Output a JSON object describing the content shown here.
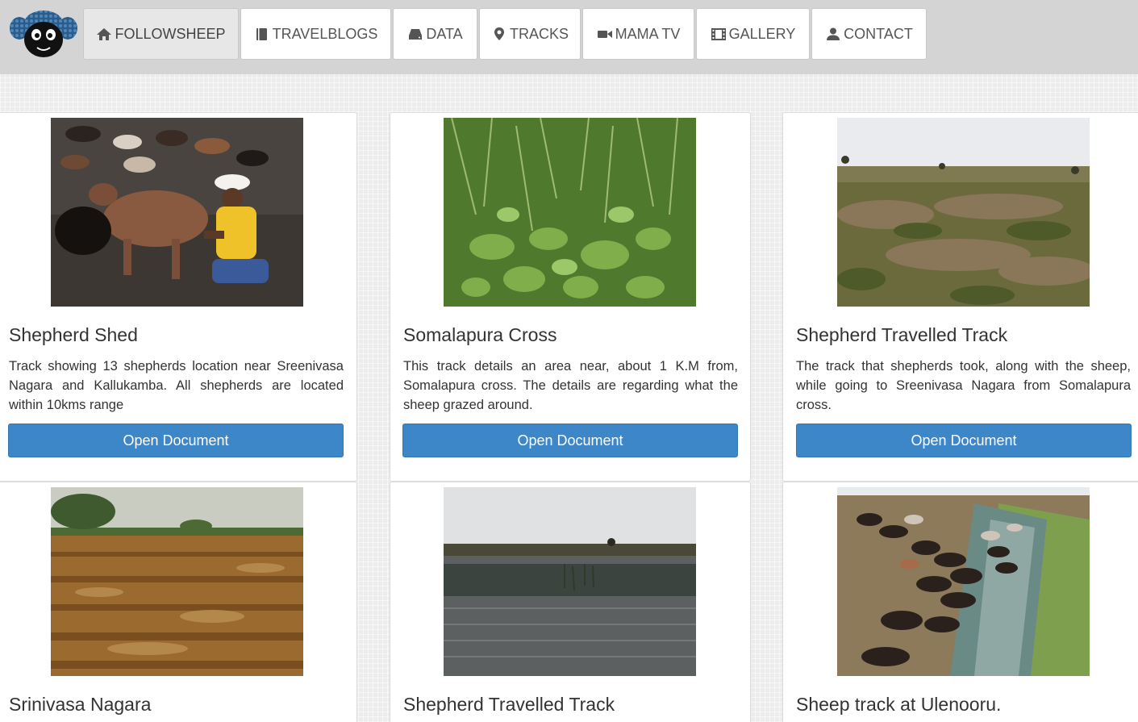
{
  "nav": {
    "items": [
      {
        "label": "FOLLOWSHEEP",
        "icon": "home-icon",
        "active": true
      },
      {
        "label": "TRAVELBLOGS",
        "icon": "book-icon",
        "active": false
      },
      {
        "label": "DATA",
        "icon": "hdd-icon",
        "active": false
      },
      {
        "label": "TRACKS",
        "icon": "map-marker-icon",
        "active": false
      },
      {
        "label": "MAMA TV",
        "icon": "video-camera-icon",
        "active": false
      },
      {
        "label": "GALLERY",
        "icon": "film-icon",
        "active": false
      },
      {
        "label": "CONTACT",
        "icon": "user-icon",
        "active": false
      }
    ]
  },
  "cards": [
    {
      "title": "Shepherd Shed",
      "text": "Track showing 13 shepherds location near Sreenivasa Nagara and Kallukamba. All shepherds are located within 10kms range",
      "button": "Open Document",
      "image": "shepherd-milking-goat-photo"
    },
    {
      "title": "Somalapura Cross",
      "text": "This track details an area near, about 1 K.M from, Somalapura cross. The details are regarding what the sheep grazed around.",
      "button": "Open Document",
      "image": "grass-weeds-closeup-photo"
    },
    {
      "title": "Shepherd Travelled Track",
      "text": "The track that shepherds took, along with the sheep, while going to Sreenivasa Nagara from Somalapura cross.",
      "button": "Open Document",
      "image": "dry-field-landscape-photo"
    },
    {
      "title": "Srinivasa Nagara",
      "image": "ploughed-field-photo"
    },
    {
      "title": "Shepherd Travelled Track",
      "image": "water-pond-photo"
    },
    {
      "title": "Sheep track at Ulenooru.",
      "image": "sheep-drinking-at-stream-photo"
    }
  ],
  "colors": {
    "navbar": "#d4d4d4",
    "button": "#3d86c8",
    "background": "#ececec"
  }
}
